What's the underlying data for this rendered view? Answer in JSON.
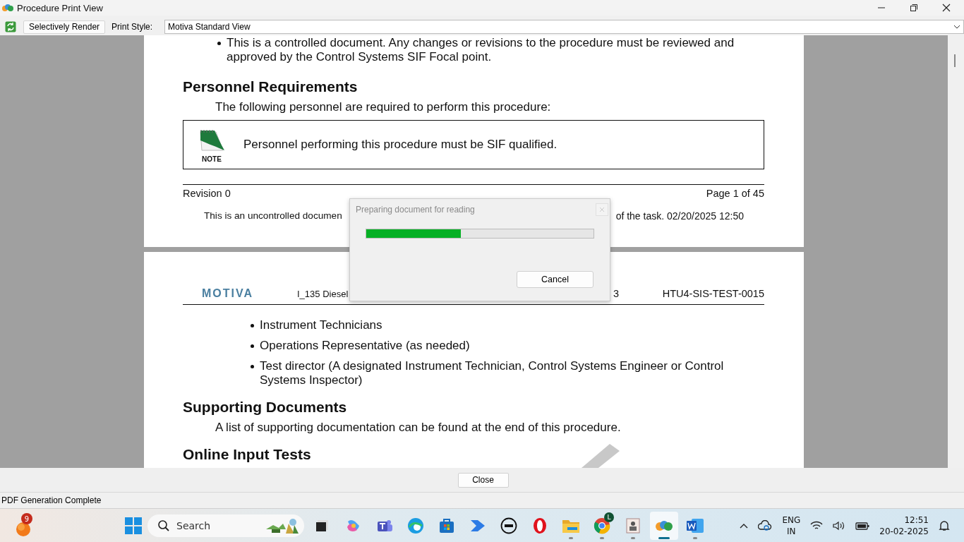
{
  "window": {
    "title": "Procedure Print View"
  },
  "toolbar": {
    "render_button": "Selectively Render",
    "print_style_label": "Print Style:",
    "print_style": "Motiva Standard View"
  },
  "page_1": {
    "bullets": [
      "This is a controlled document. Any changes or revisions to the procedure must be reviewed and approved by the Control Systems SIF Focal point."
    ],
    "heading": "Personnel Requirements",
    "intro": "The following personnel are required to perform this procedure:",
    "note": {
      "label": "NOTE",
      "text": "Personnel performing this procedure must be SIF qualified."
    },
    "footer": {
      "revision": "Revision 0",
      "page": "Page 1 of 45",
      "notice_start": "This is an uncontrolled documen",
      "notice_end": "of the task. 02/20/2025 12:50"
    }
  },
  "page_2": {
    "header": {
      "logo": "MOTIVA",
      "title_start": "I_135 Diesel",
      "title_end": "3",
      "doc_number": "HTU4-SIS-TEST-0015"
    },
    "bullets": [
      "Instrument Technicians",
      "Operations Representative (as needed)",
      "Test director (A designated Instrument Technician, Control Systems Engineer or Control Systems Inspector)"
    ],
    "sections": [
      {
        "heading": "Supporting Documents",
        "text": "A list of supporting documentation can be found at the end of this procedure."
      },
      {
        "heading": "Online Input Tests"
      }
    ]
  },
  "dialog": {
    "title": "Preparing document for reading",
    "level": 0.415,
    "cancel": "Cancel"
  },
  "close_button": "Close",
  "status_bar": "PDF Generation Complete",
  "taskbar": {
    "weather_badge": "9",
    "search_placeholder": "Search",
    "apps": [
      {
        "kind": "taskview",
        "running": false,
        "selected": false
      },
      {
        "kind": "copilot",
        "running": false,
        "selected": false
      },
      {
        "kind": "teams",
        "running": false,
        "selected": false
      },
      {
        "kind": "edge",
        "running": false,
        "selected": false
      },
      {
        "kind": "store",
        "running": false,
        "selected": false
      },
      {
        "kind": "automate",
        "running": false,
        "selected": false
      },
      {
        "kind": "dell",
        "running": false,
        "selected": false
      },
      {
        "kind": "opera",
        "running": false,
        "selected": false
      },
      {
        "kind": "folder",
        "running": true,
        "selected": false
      },
      {
        "kind": "chrome",
        "running": true,
        "selected": false,
        "badge": "L"
      },
      {
        "kind": "badge",
        "running": true,
        "selected": false
      },
      {
        "kind": "procedure",
        "running": true,
        "selected": true
      },
      {
        "kind": "word",
        "running": true,
        "selected": false
      }
    ],
    "language": "ENG",
    "region": "IN",
    "time": "12:51",
    "date": "20-02-2025"
  }
}
